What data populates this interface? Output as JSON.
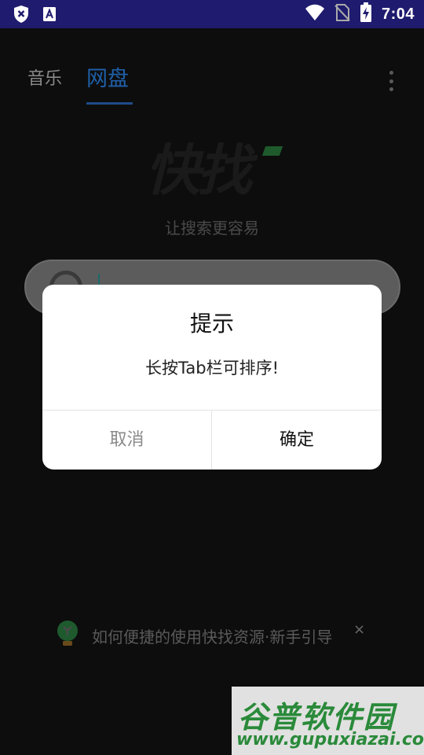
{
  "status_bar": {
    "time": "7:04",
    "icons": [
      "shield-x-icon",
      "font-a-icon",
      "wifi-icon",
      "no-sim-icon",
      "battery-charging-icon"
    ],
    "bg_color": "#1f1b6e"
  },
  "tabs": [
    {
      "label": "音乐",
      "active": false
    },
    {
      "label": "网盘",
      "active": true
    }
  ],
  "logo_text": "快找",
  "slogan": "让搜索更容易",
  "dialog": {
    "title": "提示",
    "message": "长按Tab栏可排序!",
    "cancel_label": "取消",
    "ok_label": "确定"
  },
  "guide": {
    "text": "如何便捷的使用快找资源·新手引导",
    "close": "×"
  },
  "watermark": {
    "title": "谷普软件园",
    "url": "www.gupuxiazai.com"
  },
  "colors": {
    "accent": "#1f5fa8",
    "overlay": "#0d0d0d",
    "watermark": "#2a8a3a"
  }
}
